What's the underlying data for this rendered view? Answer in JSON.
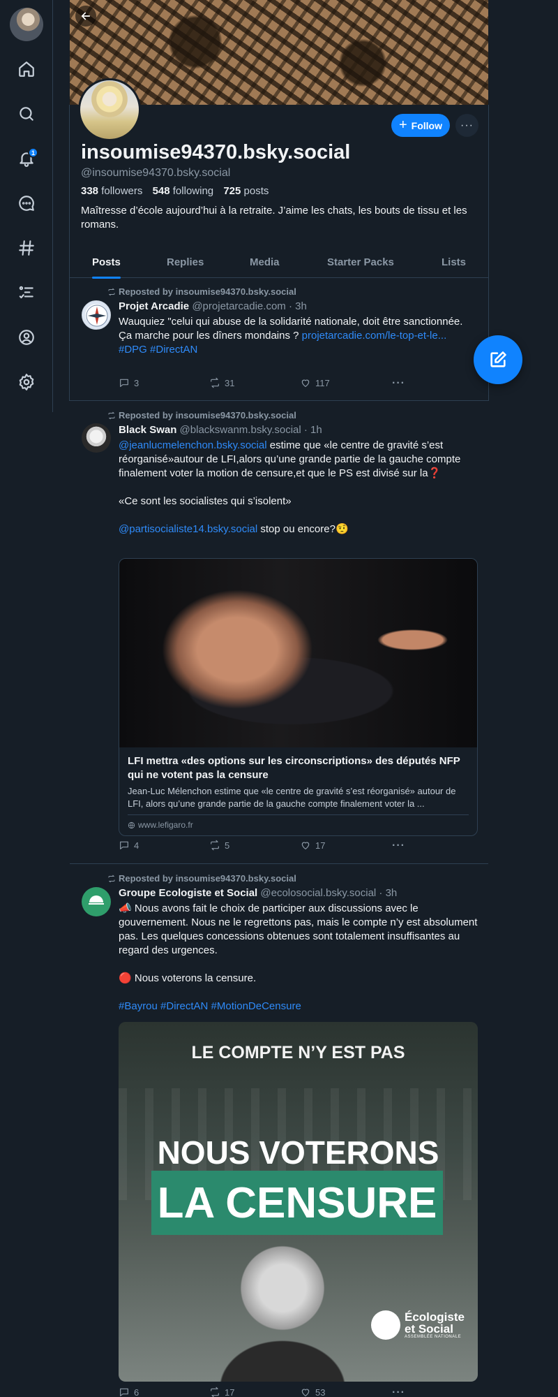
{
  "profile": {
    "display_name": "insoumise94370.bsky.social",
    "handle": "@insoumise94370.bsky.social",
    "followers_count": "338",
    "followers_label": "followers",
    "following_count": "548",
    "following_label": "following",
    "posts_count": "725",
    "posts_label": "posts",
    "bio": "Maîtresse d’école aujourd’hui à la retraite. J’aime les chats, les bouts de tissu et les romans.",
    "follow_label": "Follow"
  },
  "tabs": [
    {
      "label": "Posts",
      "active": true
    },
    {
      "label": "Replies",
      "active": false
    },
    {
      "label": "Media",
      "active": false
    },
    {
      "label": "Starter Packs",
      "active": false
    },
    {
      "label": "Lists",
      "active": false
    }
  ],
  "nav": {
    "notifications_badge": "1",
    "items": [
      "home-icon",
      "search-icon",
      "bell-icon",
      "chat-icon",
      "hashtag-icon",
      "list-icon",
      "profile-icon",
      "settings-icon"
    ]
  },
  "posts": [
    {
      "repost_label": "Reposted by insoumise94370.bsky.social",
      "author_name": "Projet Arcadie",
      "author_handle": "@projetarcadie.com",
      "time": "· 3h",
      "text_l1": "Wauquiez \"celui qui abuse de la solidarité nationale, doit être sanctionnée.",
      "text_l2": "Ça marche pour les dîners mondains ?",
      "link": "projetarcadie.com/le-top-et-le...",
      "tags": "#DPG #DirectAN",
      "replies": "3",
      "reposts": "31",
      "likes": "117"
    },
    {
      "repost_label": "Reposted by insoumise94370.bsky.social",
      "author_name": "Black Swan",
      "author_handle": "@blackswanm.bsky.social",
      "time": "· 1h",
      "mention": "@jeanlucmelenchon.bsky.social",
      "text_a": " estime que «le centre de gravité s’est réorganisé»autour de LFI,alors qu’une grande partie de la gauche compte finalement voter la motion de censure,et que le PS est divisé sur la",
      "text_a_emoji": "❓",
      "text_b": "«Ce sont les socialistes qui s’isolent»",
      "mention2": "@partisocialiste14.bsky.social",
      "text_c": " stop ou encore?",
      "text_c_emoji": "🤨",
      "card_title": "LFI mettra «des options sur les circonscriptions» des députés NFP qui ne votent pas la censure",
      "card_desc": "Jean-Luc Mélenchon estime que «le centre de gravité s’est réorganisé» autour de LFI, alors qu’une grande partie de la gauche compte finalement voter la ...",
      "card_domain": "www.lefigaro.fr",
      "replies": "4",
      "reposts": "5",
      "likes": "17"
    },
    {
      "repost_label": "Reposted by insoumise94370.bsky.social",
      "author_name": "Groupe Ecologiste et Social",
      "author_handle": "@ecolosocial.bsky.social",
      "time": "· 3h",
      "text_a_emoji": "📣",
      "text_a": " Nous avons fait le choix de participer aux discussions avec le gouvernement. Nous ne le regrettons pas, mais le compte n’y est absolument pas. Les quelques concessions obtenues sont totalement insuffisantes au regard des urgences.",
      "text_b_emoji": "🔴",
      "text_b": " Nous voterons la censure.",
      "tags": "#Bayrou #DirectAN #MotionDeCensure",
      "image_line1": "LE COMPTE N’Y EST PAS",
      "image_line2": "NOUS VOTERONS",
      "image_line3": "LA CENSURE",
      "image_logo_l1": "Écologiste",
      "image_logo_l2": "et Social",
      "image_logo_sub": "ASSEMBLÉE NATIONALE",
      "replies": "6",
      "reposts": "17",
      "likes": "53"
    }
  ],
  "colors": {
    "background": "#161e27",
    "accent": "#1083fe",
    "link": "#2f8bf9",
    "border": "#2e4052",
    "muted_text": "#8b98a5",
    "censure_green": "#2b8a6d"
  }
}
